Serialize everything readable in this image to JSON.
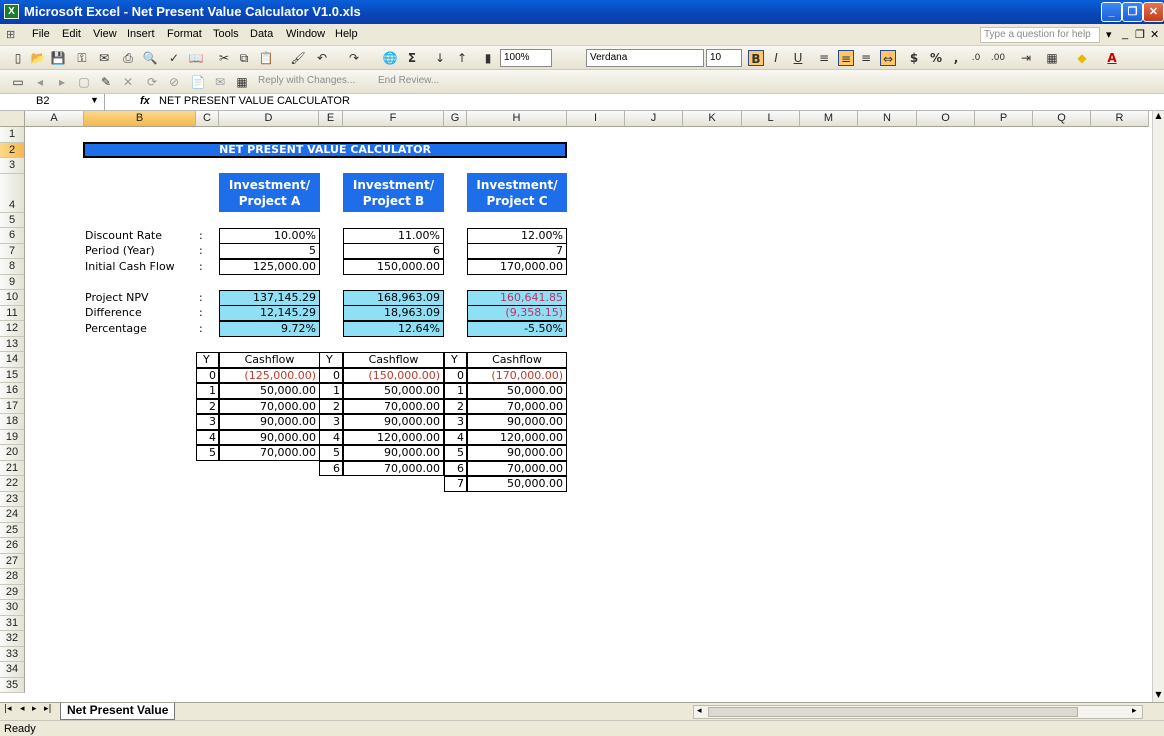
{
  "window": {
    "title": "Microsoft Excel - Net Present Value Calculator V1.0.xls"
  },
  "menu": {
    "items": [
      "File",
      "Edit",
      "View",
      "Insert",
      "Format",
      "Tools",
      "Data",
      "Window",
      "Help"
    ],
    "help_placeholder": "Type a question for help"
  },
  "toolbar": {
    "zoom": "100%",
    "font_name": "Verdana",
    "font_size": "10",
    "reply_label": "Reply with Changes...",
    "end_review_label": "End Review..."
  },
  "formula_bar": {
    "name_box": "B2",
    "fx": "fx",
    "content": "NET PRESENT VALUE CALCULATOR"
  },
  "columns": [
    "A",
    "B",
    "C",
    "D",
    "E",
    "F",
    "G",
    "H",
    "I",
    "J",
    "K",
    "L",
    "M",
    "N",
    "O",
    "P",
    "Q",
    "R"
  ],
  "rows": [
    "1",
    "2",
    "3",
    "4",
    "5",
    "6",
    "7",
    "8",
    "9",
    "10",
    "11",
    "12",
    "13",
    "14",
    "15",
    "16",
    "17",
    "18",
    "19",
    "20",
    "21",
    "22",
    "23",
    "24",
    "25",
    "26",
    "27",
    "28",
    "29",
    "30",
    "31",
    "32",
    "33",
    "34",
    "35"
  ],
  "sheet": {
    "title": "NET PRESENT VALUE CALCULATOR",
    "headers": [
      "Investment/\nProject A",
      "Investment/\nProject B",
      "Investment/\nProject C"
    ],
    "labels": [
      "Discount Rate",
      "Period (Year)",
      "Initial Cash Flow",
      "Project NPV",
      "Difference",
      "Percentage"
    ],
    "colon": ":",
    "project_a": {
      "rate": "10.00%",
      "period": "5",
      "initial": "125,000.00",
      "npv": "137,145.29",
      "diff": "12,145.29",
      "pct": "9.72%"
    },
    "project_b": {
      "rate": "11.00%",
      "period": "6",
      "initial": "150,000.00",
      "npv": "168,963.09",
      "diff": "18,963.09",
      "pct": "12.64%"
    },
    "project_c": {
      "rate": "12.00%",
      "period": "7",
      "initial": "170,000.00",
      "npv": "160,641.85",
      "diff": "(9,358.15)",
      "pct": "-5.50%"
    },
    "cf_y_header": "Y",
    "cf_header": "Cashflow",
    "cashflows_a": [
      [
        "0",
        "(125,000.00)"
      ],
      [
        "1",
        "50,000.00"
      ],
      [
        "2",
        "70,000.00"
      ],
      [
        "3",
        "90,000.00"
      ],
      [
        "4",
        "90,000.00"
      ],
      [
        "5",
        "70,000.00"
      ]
    ],
    "cashflows_b": [
      [
        "0",
        "(150,000.00)"
      ],
      [
        "1",
        "50,000.00"
      ],
      [
        "2",
        "70,000.00"
      ],
      [
        "3",
        "90,000.00"
      ],
      [
        "4",
        "120,000.00"
      ],
      [
        "5",
        "90,000.00"
      ],
      [
        "6",
        "70,000.00"
      ]
    ],
    "cashflows_c": [
      [
        "0",
        "(170,000.00)"
      ],
      [
        "1",
        "50,000.00"
      ],
      [
        "2",
        "70,000.00"
      ],
      [
        "3",
        "90,000.00"
      ],
      [
        "4",
        "120,000.00"
      ],
      [
        "5",
        "90,000.00"
      ],
      [
        "6",
        "70,000.00"
      ],
      [
        "7",
        "50,000.00"
      ]
    ]
  },
  "tabs": {
    "active": "Net Present Value"
  },
  "status": {
    "text": "Ready"
  },
  "colors": {
    "accent_blue": "#1e6eea",
    "npv_fill": "#8fe0f5",
    "negative_red": "#c0392b"
  }
}
